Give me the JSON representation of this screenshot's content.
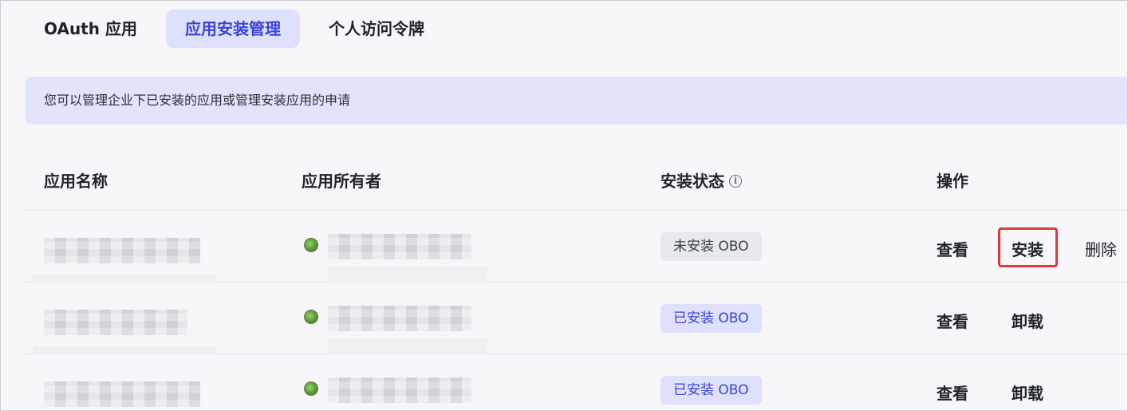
{
  "tabs": [
    {
      "label": "OAuth 应用",
      "active": false
    },
    {
      "label": "应用安装管理",
      "active": true
    },
    {
      "label": "个人访问令牌",
      "active": false
    }
  ],
  "banner": {
    "text": "您可以管理企业下已安装的应用或管理安装应用的申请"
  },
  "table": {
    "headers": {
      "name": "应用名称",
      "owner": "应用所有者",
      "status": "安装状态",
      "status_info_icon": "info-circle-icon",
      "actions": "操作"
    },
    "rows": [
      {
        "status": "未安装 OBO",
        "status_kind": "uninstalled",
        "actions": {
          "view": "查看",
          "primary": "安装",
          "secondary": "删除"
        },
        "primary_highlighted": true
      },
      {
        "status": "已安装 OBO",
        "status_kind": "installed",
        "actions": {
          "view": "查看",
          "primary": "卸载"
        }
      },
      {
        "status": "已安装 OBO",
        "status_kind": "installed",
        "actions": {
          "view": "查看",
          "primary": "卸载"
        }
      }
    ]
  },
  "colors": {
    "accent": "#3b44d6",
    "accent_bg": "#dfe1fc",
    "highlight_border": "#e0393c"
  }
}
